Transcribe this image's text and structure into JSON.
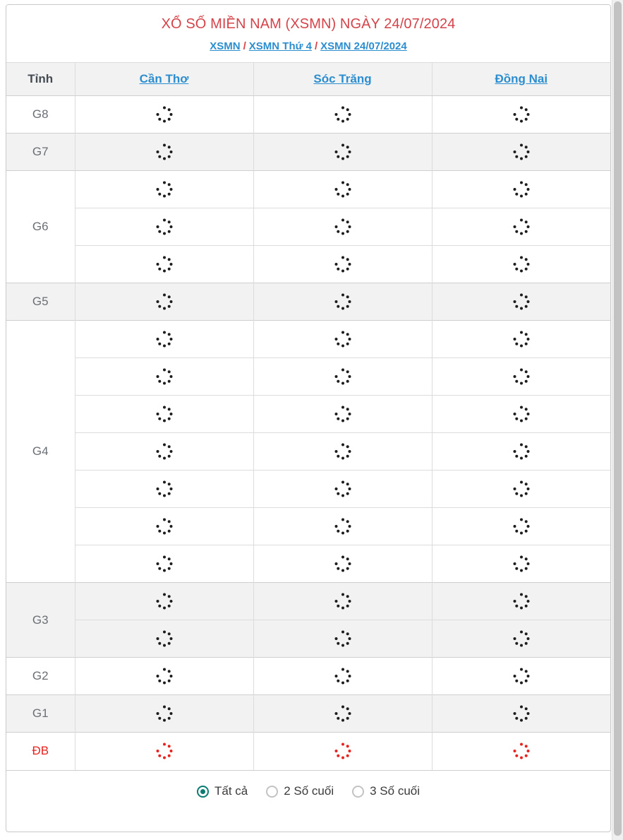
{
  "header": {
    "title": "XỔ SỐ MIỀN NAM (XSMN) NGÀY 24/07/2024",
    "breadcrumb": [
      {
        "label": "XSMN"
      },
      {
        "label": "XSMN Thứ 4"
      },
      {
        "label": "XSMN 24/07/2024"
      }
    ],
    "separator": "/"
  },
  "table": {
    "columns": [
      {
        "key": "tinh",
        "label": "Tỉnh",
        "link": false
      },
      {
        "key": "can_tho",
        "label": "Cần Thơ",
        "link": true
      },
      {
        "key": "soc_trang",
        "label": "Sóc Trăng",
        "link": true
      },
      {
        "key": "dong_nai",
        "label": "Đồng Nai",
        "link": true
      }
    ],
    "rows": [
      {
        "label": "G8",
        "rows": 1,
        "shaded": false,
        "highlight": false,
        "cells": [
          [
            "loading-spinner",
            "loading-spinner",
            "loading-spinner"
          ]
        ]
      },
      {
        "label": "G7",
        "rows": 1,
        "shaded": true,
        "highlight": false,
        "cells": [
          [
            "loading-spinner",
            "loading-spinner",
            "loading-spinner"
          ]
        ]
      },
      {
        "label": "G6",
        "rows": 3,
        "shaded": false,
        "highlight": false,
        "cells": [
          [
            "loading-spinner",
            "loading-spinner",
            "loading-spinner"
          ],
          [
            "loading-spinner",
            "loading-spinner",
            "loading-spinner"
          ],
          [
            "loading-spinner",
            "loading-spinner",
            "loading-spinner"
          ]
        ]
      },
      {
        "label": "G5",
        "rows": 1,
        "shaded": true,
        "highlight": false,
        "cells": [
          [
            "loading-spinner",
            "loading-spinner",
            "loading-spinner"
          ]
        ]
      },
      {
        "label": "G4",
        "rows": 7,
        "shaded": false,
        "highlight": false,
        "cells": [
          [
            "loading-spinner",
            "loading-spinner",
            "loading-spinner"
          ],
          [
            "loading-spinner",
            "loading-spinner",
            "loading-spinner"
          ],
          [
            "loading-spinner",
            "loading-spinner",
            "loading-spinner"
          ],
          [
            "loading-spinner",
            "loading-spinner",
            "loading-spinner"
          ],
          [
            "loading-spinner",
            "loading-spinner",
            "loading-spinner"
          ],
          [
            "loading-spinner",
            "loading-spinner",
            "loading-spinner"
          ],
          [
            "loading-spinner",
            "loading-spinner",
            "loading-spinner"
          ]
        ]
      },
      {
        "label": "G3",
        "rows": 2,
        "shaded": true,
        "highlight": false,
        "cells": [
          [
            "loading-spinner",
            "loading-spinner",
            "loading-spinner"
          ],
          [
            "loading-spinner",
            "loading-spinner",
            "loading-spinner"
          ]
        ]
      },
      {
        "label": "G2",
        "rows": 1,
        "shaded": false,
        "highlight": false,
        "cells": [
          [
            "loading-spinner",
            "loading-spinner",
            "loading-spinner"
          ]
        ]
      },
      {
        "label": "G1",
        "rows": 1,
        "shaded": true,
        "highlight": false,
        "cells": [
          [
            "loading-spinner",
            "loading-spinner",
            "loading-spinner"
          ]
        ]
      },
      {
        "label": "ĐB",
        "rows": 1,
        "shaded": false,
        "highlight": true,
        "cells": [
          [
            "loading-spinner",
            "loading-spinner",
            "loading-spinner"
          ]
        ]
      }
    ]
  },
  "footer": {
    "options": [
      {
        "label": "Tất cả",
        "selected": true
      },
      {
        "label": "2 Số cuối",
        "selected": false
      },
      {
        "label": "3 Số cuối",
        "selected": false
      }
    ]
  },
  "colors": {
    "title_red": "#d4434a",
    "link_blue": "#2c8ecf",
    "db_red": "#e8231f",
    "radio_teal": "#0c7b72",
    "row_shade": "#f2f2f2"
  },
  "scrollbar": {
    "orientation": "vertical",
    "position": "top"
  }
}
